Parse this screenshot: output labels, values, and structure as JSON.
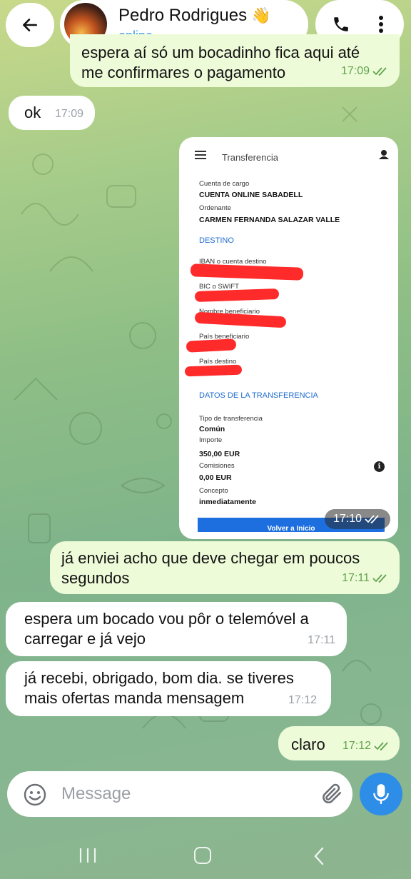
{
  "header": {
    "contact_name": "Pedro Rodrigues",
    "name_emoji": "👋",
    "status": "online"
  },
  "messages": [
    {
      "dir": "out",
      "lines": [
        "espera aí só um bocadinho fica aqui até",
        "me confirmares o pagamento"
      ],
      "time": "17:09",
      "read": true
    },
    {
      "dir": "in",
      "text": "ok",
      "time": "17:09"
    },
    {
      "dir": "out",
      "lines": [
        "já enviei acho que deve chegar em poucos",
        "segundos"
      ],
      "time": "17:11",
      "read": true
    },
    {
      "dir": "in",
      "lines": [
        "espera um bocado vou pôr o telemóvel a",
        "carregar e já vejo"
      ],
      "time": "17:11"
    },
    {
      "dir": "in",
      "lines": [
        "já recebi, obrigado, bom dia. se tiveres",
        "mais ofertas manda mensagem"
      ],
      "time": "17:12"
    },
    {
      "dir": "out",
      "text": "claro",
      "time": "17:12",
      "read": true
    }
  ],
  "image_message": {
    "time": "17:10",
    "screen_title": "Transferencia",
    "cuenta_label": "Cuenta de cargo",
    "cuenta_value": "CUENTA ONLINE SABADELL",
    "ordenante_label": "Ordenante",
    "ordenante_value": "CARMEN FERNANDA SALAZAR VALLE",
    "destino_heading": "DESTINO",
    "iban_label": "IBAN o cuenta destino",
    "bic_label": "BIC o SWIFT",
    "beneficiario_label": "Nombre beneficiario",
    "pais_benef_label": "País beneficiario",
    "pais_destino_label": "País destino",
    "datos_heading": "DATOS DE LA TRANSFERENCIA",
    "tipo_label": "Tipo de transferencia",
    "tipo_value": "Común",
    "importe_label": "Importe",
    "importe_value": "350,00 EUR",
    "comisiones_label": "Comisiones",
    "comisiones_value": "0,00 EUR",
    "concepto_label": "Concepto",
    "concepto_value": "inmediatamente",
    "button_label": "Volver a Inicio"
  },
  "composer": {
    "placeholder": "Message"
  },
  "colors": {
    "outgoing_bubble": "#eefbd9",
    "incoming_bubble": "#ffffff",
    "accent": "#2e8de6",
    "read_check": "#5fa34a"
  },
  "icons": [
    "back-arrow-icon",
    "phone-icon",
    "more-vert-icon",
    "emoji-icon",
    "paperclip-icon",
    "microphone-icon",
    "hamburger-menu-icon",
    "user-icon",
    "info-icon",
    "double-check-icon"
  ]
}
